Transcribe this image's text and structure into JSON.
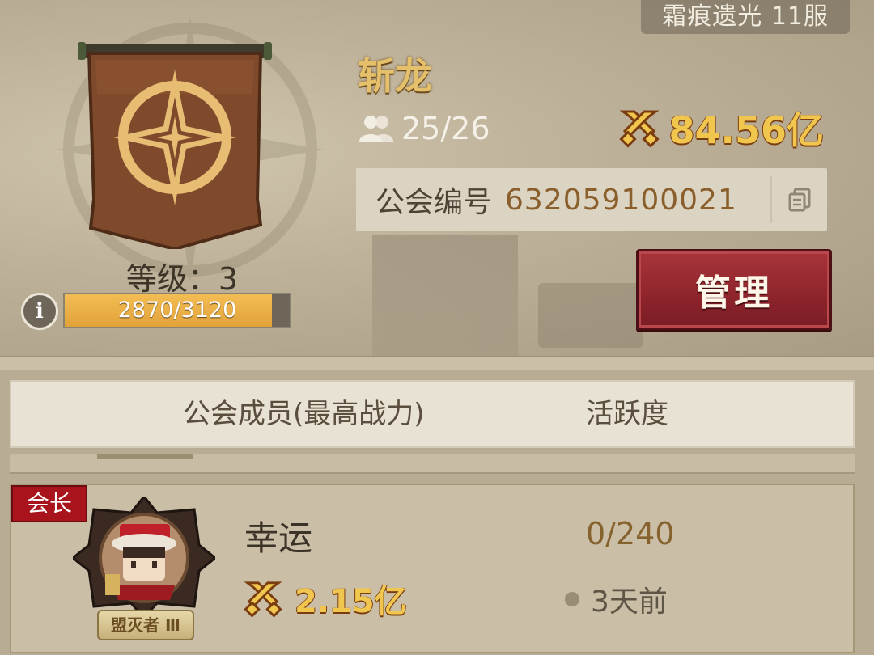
{
  "server": {
    "label": "霜痕遗光 11服"
  },
  "guild": {
    "name": "斩龙",
    "members": "25/26",
    "power": "84.56亿",
    "id_label": "公会编号",
    "id_value": "632059100021",
    "manage_label": "管理",
    "level_label": "等级：3",
    "xp_text": "2870/3120",
    "xp_progress": 0.9199
  },
  "tabs": [
    {
      "label": "公会成员(最高战力)"
    },
    {
      "label": "活跃度"
    }
  ],
  "member_list": [
    {
      "role": "会长",
      "name": "幸运",
      "power": "2.15亿",
      "activity": "0/240",
      "last_seen": "3天前",
      "title_plate": "盟灭者 Ⅲ"
    }
  ],
  "icons": {
    "members": "people-icon",
    "power": "crossed-swords-icon",
    "copy": "copy-icon",
    "info": "info-icon"
  },
  "colors": {
    "gold_text": "#f0c64e",
    "manage_button": "#8e242c",
    "role_badge": "#a8131c",
    "xp_fill": "#e2a23a"
  }
}
